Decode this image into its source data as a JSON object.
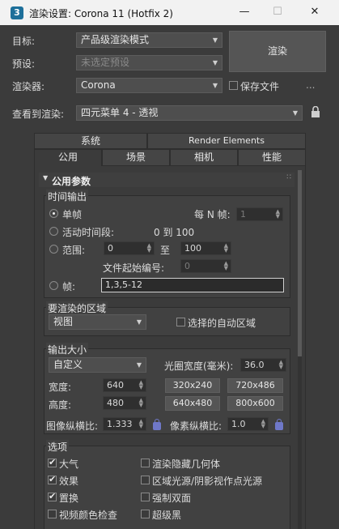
{
  "window": {
    "title": "渲染设置: Corona 11 (Hotfix 2)",
    "icon_label": "3"
  },
  "top": {
    "target_label": "目标:",
    "target_value": "产品级渲染模式",
    "preset_label": "预设:",
    "preset_value": "未选定预设",
    "renderer_label": "渲染器:",
    "renderer_value": "Corona",
    "render_button": "渲染",
    "save_file_label": "保存文件",
    "more_label": "...",
    "view_label": "查看到渲染:",
    "view_value": "四元菜单 4 - 透视"
  },
  "tabs_row1": [
    "系统",
    "Render Elements"
  ],
  "tabs_row2": [
    "公用",
    "场景",
    "相机",
    "性能"
  ],
  "rollout": {
    "title": "公用参数",
    "dots": "∷"
  },
  "time_output": {
    "title": "时间输出",
    "single_label": "单帧",
    "every_n_label": "每 N 帧:",
    "every_n_value": "1",
    "active_label": "活动时间段:",
    "active_range": "0 到 100",
    "range_label": "范围:",
    "range_from": "0",
    "range_to_label": "至",
    "range_to": "100",
    "file_start_label": "文件起始编号:",
    "file_start_value": "0",
    "frames_label": "帧:",
    "frames_value": "1,3,5-12"
  },
  "area": {
    "title": "要渲染的区域",
    "value": "视图",
    "auto_region_label": "选择的自动区域"
  },
  "output_size": {
    "title": "输出大小",
    "preset": "自定义",
    "aperture_label": "光圈宽度(毫米):",
    "aperture_value": "36.0",
    "width_label": "宽度:",
    "width_value": "640",
    "height_label": "高度:",
    "height_value": "480",
    "presets": [
      "320x240",
      "720x486",
      "640x480",
      "800x600"
    ],
    "image_aspect_label": "图像纵横比:",
    "image_aspect_value": "1.333",
    "pixel_aspect_label": "像素纵横比:",
    "pixel_aspect_value": "1.0"
  },
  "options": {
    "title": "选项",
    "atmosphere": "大气",
    "effects": "效果",
    "displacement": "置换",
    "video_check": "视频颜色检查",
    "render_hidden": "渲染隐藏几何体",
    "area_lights": "区域光源/阴影视作点光源",
    "force_2side": "强制双面",
    "super_black": "超级黑"
  },
  "colors": {
    "panel": "#3b3b3b",
    "titlebar": "#f2f2f2",
    "lock": "#6f78c8"
  }
}
